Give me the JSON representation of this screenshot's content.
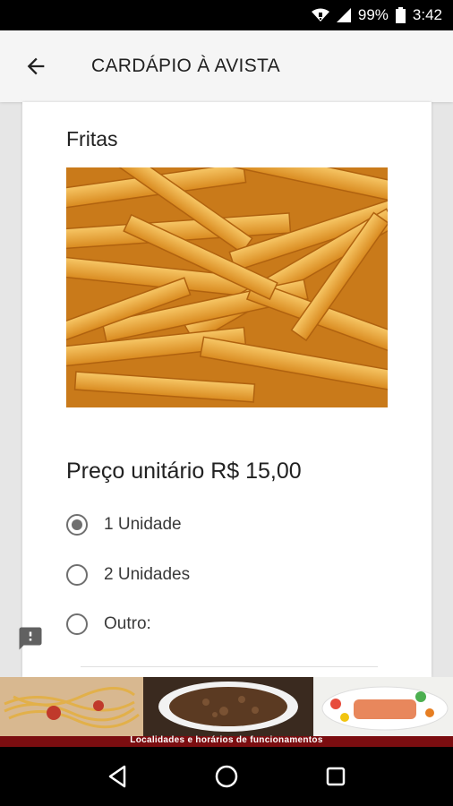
{
  "status_bar": {
    "battery_percent": "99%",
    "time": "3:42"
  },
  "app_bar": {
    "title": "CARDÁPIO À AVISTA"
  },
  "item": {
    "name": "Fritas",
    "price_label": "Preço unitário R$ 15,00",
    "image": "french-fries-photo"
  },
  "options": [
    {
      "label": "1 Unidade",
      "selected": true
    },
    {
      "label": "2 Unidades",
      "selected": false
    },
    {
      "label": "Outro:",
      "selected": false
    }
  ],
  "ad": {
    "caption": "Localidades e horários de funcionamentos"
  },
  "colors": {
    "accent_gray": "#6f6f6f",
    "ad_background": "#8a0f12"
  }
}
